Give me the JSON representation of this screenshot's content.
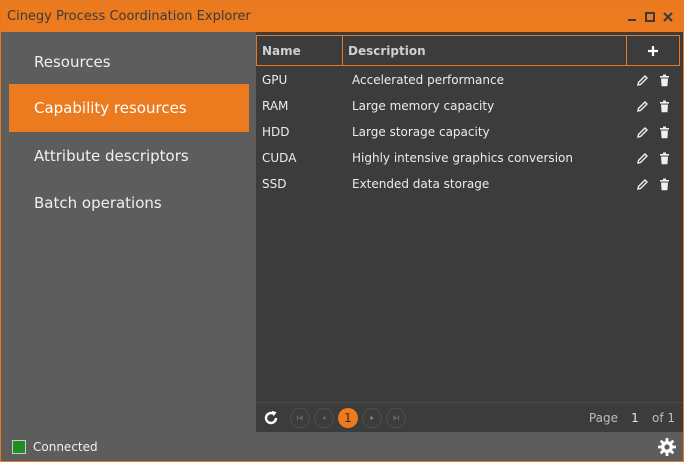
{
  "window": {
    "title": "Cinegy Process Coordination Explorer",
    "accent": "#ec7a1e"
  },
  "sidebar": {
    "items": [
      {
        "label": "Resources",
        "active": false
      },
      {
        "label": "Capability resources",
        "active": true
      },
      {
        "label": "Attribute descriptors",
        "active": false
      },
      {
        "label": "Batch operations",
        "active": false
      }
    ]
  },
  "grid": {
    "columns": {
      "name": "Name",
      "description": "Description",
      "add_icon": "plus-icon"
    },
    "rows": [
      {
        "name": "GPU",
        "description": "Accelerated performance"
      },
      {
        "name": "RAM",
        "description": "Large memory capacity"
      },
      {
        "name": "HDD",
        "description": "Large storage capacity"
      },
      {
        "name": "CUDA",
        "description": "Highly intensive graphics conversion"
      },
      {
        "name": "SSD",
        "description": "Extended data storage"
      }
    ],
    "row_actions": [
      "pencil-icon",
      "trash-icon"
    ]
  },
  "pager": {
    "current_page": "1",
    "page_label": "Page",
    "page_input": "1",
    "of_label": "of 1"
  },
  "status": {
    "text": "Connected",
    "color": "#1e8e1e"
  }
}
